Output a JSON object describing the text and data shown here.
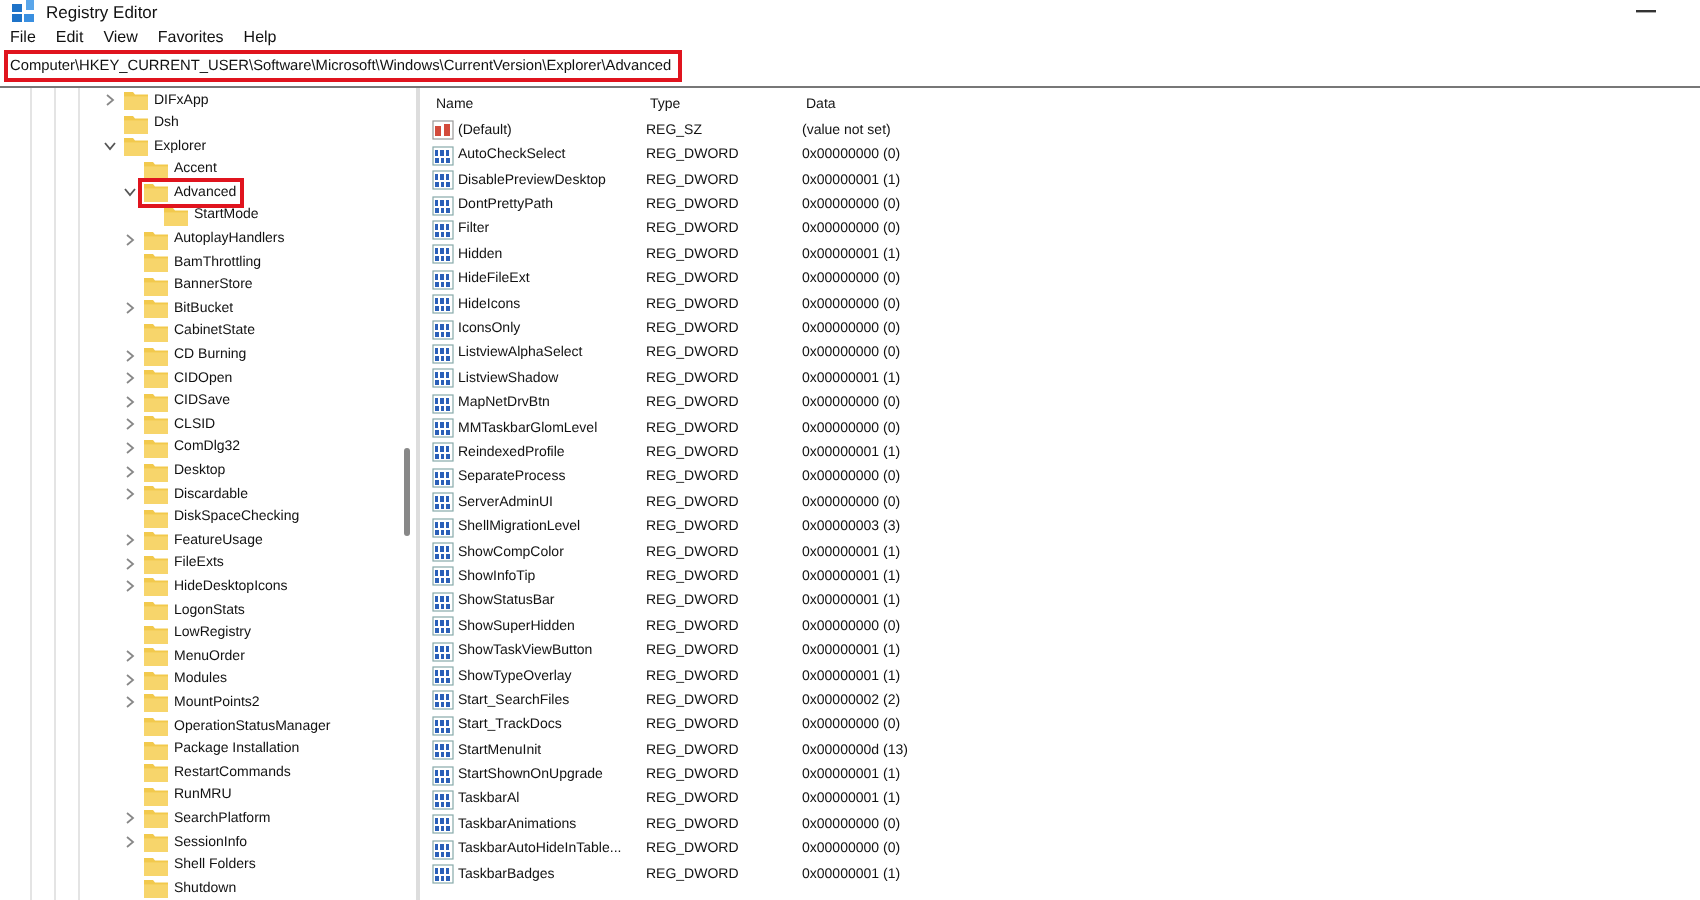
{
  "window": {
    "title": "Registry Editor"
  },
  "menu": [
    "File",
    "Edit",
    "View",
    "Favorites",
    "Help"
  ],
  "address": "Computer\\HKEY_CURRENT_USER\\Software\\Microsoft\\Windows\\CurrentVersion\\Explorer\\Advanced",
  "tree": [
    {
      "name": "DIFxApp",
      "has_children": true,
      "expanded": false,
      "selected": false
    },
    {
      "name": "Dsh",
      "has_children": false,
      "expanded": false,
      "selected": false
    },
    {
      "name": "Explorer",
      "has_children": true,
      "expanded": true,
      "selected": false,
      "children": [
        {
          "name": "Accent",
          "has_children": false,
          "expanded": false,
          "selected": false
        },
        {
          "name": "Advanced",
          "has_children": true,
          "expanded": true,
          "selected": true,
          "children": [
            {
              "name": "StartMode",
              "has_children": false,
              "expanded": false,
              "selected": false
            }
          ]
        },
        {
          "name": "AutoplayHandlers",
          "has_children": true,
          "expanded": false,
          "selected": false
        },
        {
          "name": "BamThrottling",
          "has_children": false,
          "expanded": false,
          "selected": false
        },
        {
          "name": "BannerStore",
          "has_children": false,
          "expanded": false,
          "selected": false
        },
        {
          "name": "BitBucket",
          "has_children": true,
          "expanded": false,
          "selected": false
        },
        {
          "name": "CabinetState",
          "has_children": false,
          "expanded": false,
          "selected": false
        },
        {
          "name": "CD Burning",
          "has_children": true,
          "expanded": false,
          "selected": false
        },
        {
          "name": "CIDOpen",
          "has_children": true,
          "expanded": false,
          "selected": false
        },
        {
          "name": "CIDSave",
          "has_children": true,
          "expanded": false,
          "selected": false
        },
        {
          "name": "CLSID",
          "has_children": true,
          "expanded": false,
          "selected": false
        },
        {
          "name": "ComDlg32",
          "has_children": true,
          "expanded": false,
          "selected": false
        },
        {
          "name": "Desktop",
          "has_children": true,
          "expanded": false,
          "selected": false
        },
        {
          "name": "Discardable",
          "has_children": true,
          "expanded": false,
          "selected": false
        },
        {
          "name": "DiskSpaceChecking",
          "has_children": false,
          "expanded": false,
          "selected": false
        },
        {
          "name": "FeatureUsage",
          "has_children": true,
          "expanded": false,
          "selected": false
        },
        {
          "name": "FileExts",
          "has_children": true,
          "expanded": false,
          "selected": false
        },
        {
          "name": "HideDesktopIcons",
          "has_children": true,
          "expanded": false,
          "selected": false
        },
        {
          "name": "LogonStats",
          "has_children": false,
          "expanded": false,
          "selected": false
        },
        {
          "name": "LowRegistry",
          "has_children": false,
          "expanded": false,
          "selected": false
        },
        {
          "name": "MenuOrder",
          "has_children": true,
          "expanded": false,
          "selected": false
        },
        {
          "name": "Modules",
          "has_children": true,
          "expanded": false,
          "selected": false
        },
        {
          "name": "MountPoints2",
          "has_children": true,
          "expanded": false,
          "selected": false
        },
        {
          "name": "OperationStatusManager",
          "has_children": false,
          "expanded": false,
          "selected": false
        },
        {
          "name": "Package Installation",
          "has_children": false,
          "expanded": false,
          "selected": false
        },
        {
          "name": "RestartCommands",
          "has_children": false,
          "expanded": false,
          "selected": false
        },
        {
          "name": "RunMRU",
          "has_children": false,
          "expanded": false,
          "selected": false
        },
        {
          "name": "SearchPlatform",
          "has_children": true,
          "expanded": false,
          "selected": false
        },
        {
          "name": "SessionInfo",
          "has_children": true,
          "expanded": false,
          "selected": false
        },
        {
          "name": "Shell Folders",
          "has_children": false,
          "expanded": false,
          "selected": false
        },
        {
          "name": "Shutdown",
          "has_children": false,
          "expanded": false,
          "selected": false
        }
      ]
    }
  ],
  "table": {
    "columns": [
      "Name",
      "Type",
      "Data"
    ],
    "rows": [
      {
        "kind": "string",
        "name": "(Default)",
        "type": "REG_SZ",
        "data": "(value not set)"
      },
      {
        "kind": "dword",
        "name": "AutoCheckSelect",
        "type": "REG_DWORD",
        "data": "0x00000000 (0)"
      },
      {
        "kind": "dword",
        "name": "DisablePreviewDesktop",
        "type": "REG_DWORD",
        "data": "0x00000001 (1)"
      },
      {
        "kind": "dword",
        "name": "DontPrettyPath",
        "type": "REG_DWORD",
        "data": "0x00000000 (0)"
      },
      {
        "kind": "dword",
        "name": "Filter",
        "type": "REG_DWORD",
        "data": "0x00000000 (0)"
      },
      {
        "kind": "dword",
        "name": "Hidden",
        "type": "REG_DWORD",
        "data": "0x00000001 (1)"
      },
      {
        "kind": "dword",
        "name": "HideFileExt",
        "type": "REG_DWORD",
        "data": "0x00000000 (0)"
      },
      {
        "kind": "dword",
        "name": "HideIcons",
        "type": "REG_DWORD",
        "data": "0x00000000 (0)"
      },
      {
        "kind": "dword",
        "name": "IconsOnly",
        "type": "REG_DWORD",
        "data": "0x00000000 (0)"
      },
      {
        "kind": "dword",
        "name": "ListviewAlphaSelect",
        "type": "REG_DWORD",
        "data": "0x00000000 (0)"
      },
      {
        "kind": "dword",
        "name": "ListviewShadow",
        "type": "REG_DWORD",
        "data": "0x00000001 (1)"
      },
      {
        "kind": "dword",
        "name": "MapNetDrvBtn",
        "type": "REG_DWORD",
        "data": "0x00000000 (0)"
      },
      {
        "kind": "dword",
        "name": "MMTaskbarGlomLevel",
        "type": "REG_DWORD",
        "data": "0x00000000 (0)"
      },
      {
        "kind": "dword",
        "name": "ReindexedProfile",
        "type": "REG_DWORD",
        "data": "0x00000001 (1)"
      },
      {
        "kind": "dword",
        "name": "SeparateProcess",
        "type": "REG_DWORD",
        "data": "0x00000000 (0)"
      },
      {
        "kind": "dword",
        "name": "ServerAdminUI",
        "type": "REG_DWORD",
        "data": "0x00000000 (0)"
      },
      {
        "kind": "dword",
        "name": "ShellMigrationLevel",
        "type": "REG_DWORD",
        "data": "0x00000003 (3)"
      },
      {
        "kind": "dword",
        "name": "ShowCompColor",
        "type": "REG_DWORD",
        "data": "0x00000001 (1)"
      },
      {
        "kind": "dword",
        "name": "ShowInfoTip",
        "type": "REG_DWORD",
        "data": "0x00000001 (1)"
      },
      {
        "kind": "dword",
        "name": "ShowStatusBar",
        "type": "REG_DWORD",
        "data": "0x00000001 (1)"
      },
      {
        "kind": "dword",
        "name": "ShowSuperHidden",
        "type": "REG_DWORD",
        "data": "0x00000000 (0)"
      },
      {
        "kind": "dword",
        "name": "ShowTaskViewButton",
        "type": "REG_DWORD",
        "data": "0x00000001 (1)"
      },
      {
        "kind": "dword",
        "name": "ShowTypeOverlay",
        "type": "REG_DWORD",
        "data": "0x00000001 (1)"
      },
      {
        "kind": "dword",
        "name": "Start_SearchFiles",
        "type": "REG_DWORD",
        "data": "0x00000002 (2)"
      },
      {
        "kind": "dword",
        "name": "Start_TrackDocs",
        "type": "REG_DWORD",
        "data": "0x00000000 (0)"
      },
      {
        "kind": "dword",
        "name": "StartMenuInit",
        "type": "REG_DWORD",
        "data": "0x0000000d (13)"
      },
      {
        "kind": "dword",
        "name": "StartShownOnUpgrade",
        "type": "REG_DWORD",
        "data": "0x00000001 (1)"
      },
      {
        "kind": "dword",
        "name": "TaskbarAl",
        "type": "REG_DWORD",
        "data": "0x00000001 (1)"
      },
      {
        "kind": "dword",
        "name": "TaskbarAnimations",
        "type": "REG_DWORD",
        "data": "0x00000000 (0)"
      },
      {
        "kind": "dword",
        "name": "TaskbarAutoHideInTable...",
        "type": "REG_DWORD",
        "data": "0x00000000 (0)"
      },
      {
        "kind": "dword",
        "name": "TaskbarBadges",
        "type": "REG_DWORD",
        "data": "0x00000001 (1)"
      }
    ]
  }
}
